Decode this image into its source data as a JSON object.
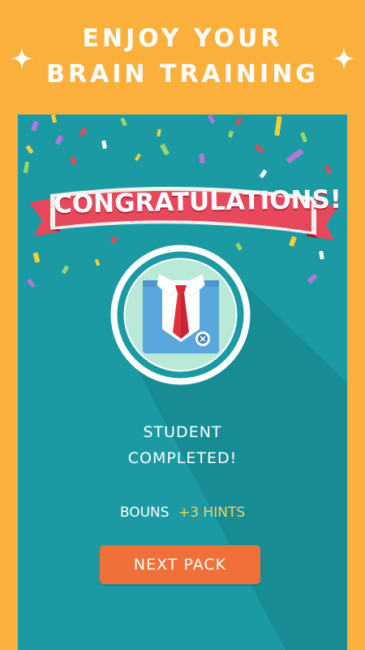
{
  "header": {
    "line1": "ENJOY YOUR",
    "line2": "BRAIN TRAINING"
  },
  "banner": {
    "text": "CONGRATULATIONS!"
  },
  "badge": {
    "icon": "shirt-and-tie-icon"
  },
  "completion": {
    "line1": "STUDENT",
    "line2": "COMPLETED!"
  },
  "bonus": {
    "label": "BOUNS",
    "value": "+3 HINTS"
  },
  "next_button": {
    "label": "NEXT PACK"
  },
  "colors": {
    "background": "#fbb03b",
    "panel": "#1b9aa3",
    "banner": "#e7485c",
    "button": "#f0703a",
    "bonus_value": "#fcd34a"
  }
}
